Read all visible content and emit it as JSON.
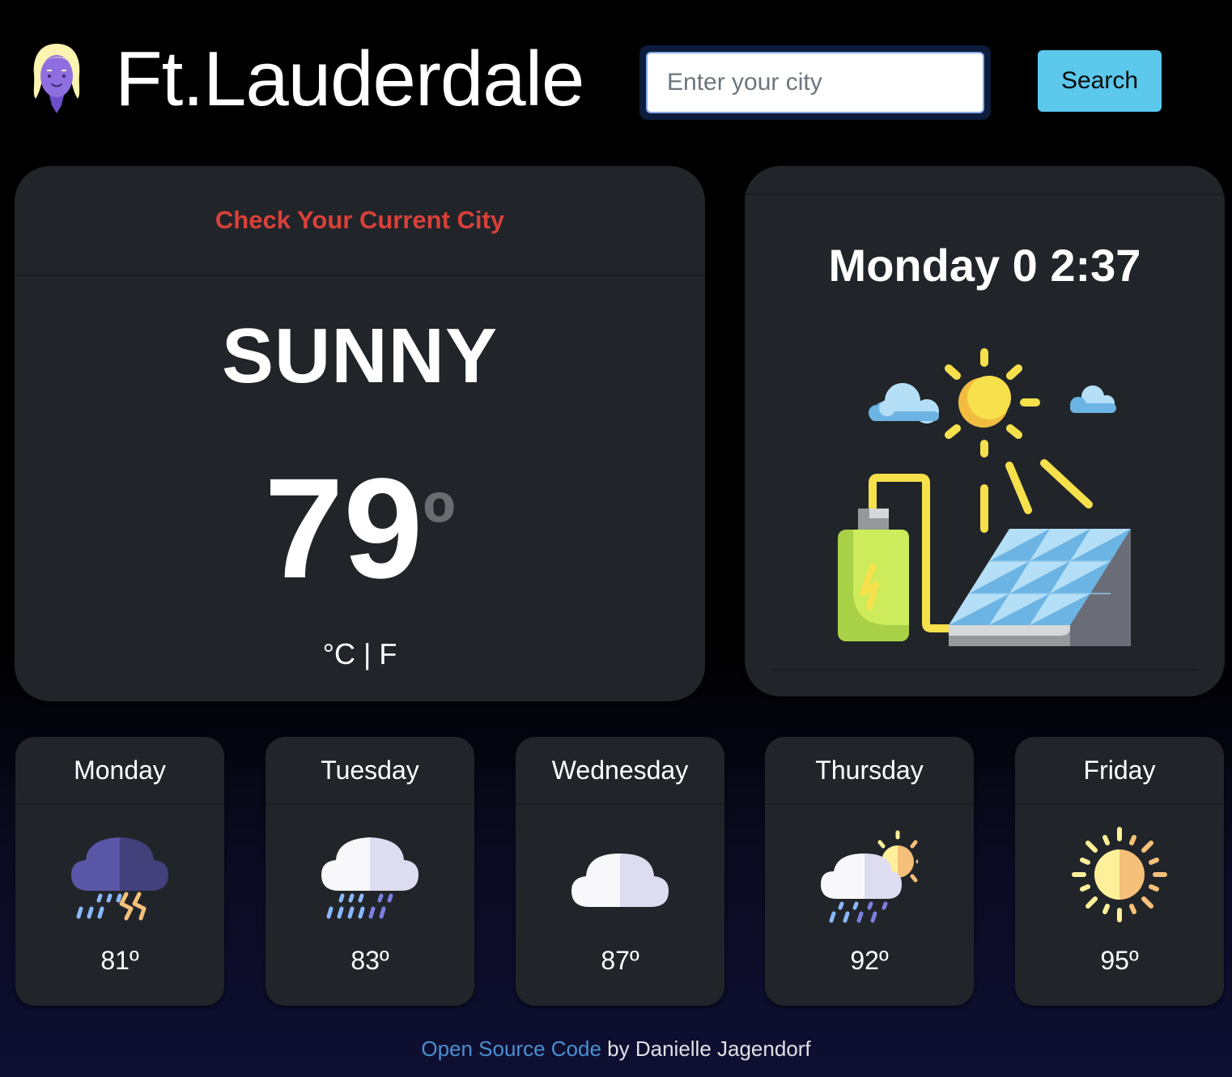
{
  "header": {
    "city": "Ft.Lauderdale",
    "avatar_icon": "woman-avatar-icon",
    "search": {
      "placeholder": "Enter your city",
      "value": ""
    },
    "search_button": "Search"
  },
  "current": {
    "header_text": "Check Your Current City",
    "condition": "SUNNY",
    "temperature": "79",
    "degree_symbol": "º",
    "unit_c": "°C",
    "unit_separator": "|",
    "unit_f": "F"
  },
  "clock": {
    "text": "Monday 0 2:37",
    "illustration": "solar-panel-battery-sun-icon"
  },
  "forecast": [
    {
      "day": "Monday",
      "temp": "81º",
      "icon": "thunderstorm-icon"
    },
    {
      "day": "Tuesday",
      "temp": "83º",
      "icon": "rain-cloud-icon"
    },
    {
      "day": "Wednesday",
      "temp": "87º",
      "icon": "cloud-icon"
    },
    {
      "day": "Thursday",
      "temp": "92º",
      "icon": "sun-rain-cloud-icon"
    },
    {
      "day": "Friday",
      "temp": "95º",
      "icon": "sun-icon"
    }
  ],
  "footer": {
    "link_text": "Open Source Code",
    "suffix": " by Danielle Jagendorf"
  },
  "colors": {
    "accent_red": "#d9403a",
    "search_button": "#5bc8ec",
    "card_bg": "#212529",
    "link": "#4a90d0"
  }
}
